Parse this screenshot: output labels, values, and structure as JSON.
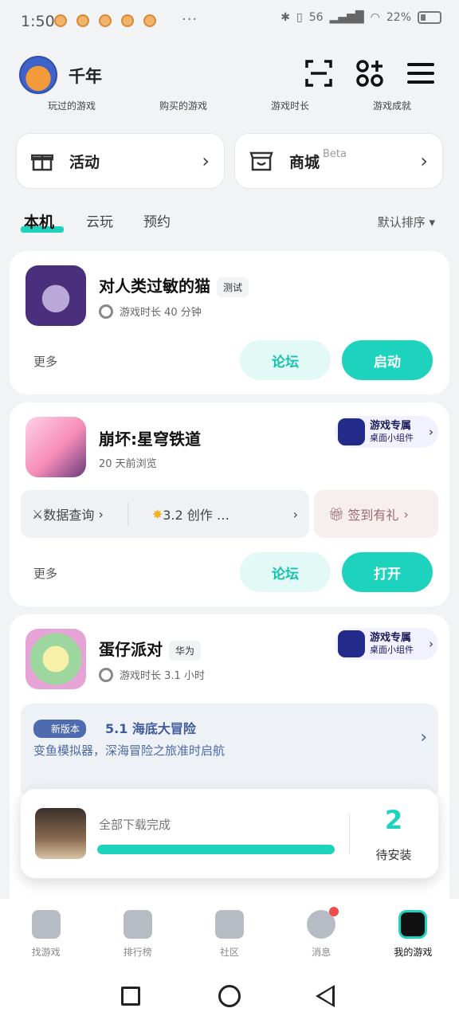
{
  "status": {
    "time": "1:50",
    "dots": "···",
    "network": "56",
    "battery": "22%"
  },
  "header": {
    "username": "千年",
    "subtabs": [
      "玩过的游戏",
      "购买的游戏",
      "游戏时长",
      "游戏成就"
    ]
  },
  "entries": {
    "activity": "活动",
    "store": "商城",
    "store_badge": "Beta"
  },
  "tabs": [
    "本机",
    "云玩",
    "预约"
  ],
  "sort": "默认排序 ▾",
  "games": [
    {
      "title": "对人类过敏的猫",
      "tag": "测试",
      "meta": "游戏时长 40 分钟",
      "more": "更多",
      "forum": "论坛",
      "action": "启动"
    },
    {
      "title": "崩坏:星穹铁道",
      "meta": "20 天前浏览",
      "widget_title": "游戏专属",
      "widget_sub": "桌面小组件",
      "quick1": "数据查询",
      "quick2": "3.2 创作 …",
      "gift": "签到有礼",
      "more": "更多",
      "forum": "论坛",
      "action": "打开"
    },
    {
      "title": "蛋仔派对",
      "tag": "华为",
      "meta": "游戏时长 3.1 小时",
      "widget_title": "游戏专属",
      "widget_sub": "桌面小组件",
      "news_badge": "新版本",
      "news_title": "5.1 海底大冒险",
      "news_sub": "变鱼模拟器，深海冒险之旅准时启航"
    }
  ],
  "download": {
    "status": "全部下载完成",
    "progress": 1.0,
    "count": "2",
    "pending_label": "待安装"
  },
  "nav": [
    "找游戏",
    "排行榜",
    "社区",
    "消息",
    "我的游戏"
  ],
  "colors": {
    "accent": "#1dd3be",
    "badge_red": "#f24b4b"
  }
}
